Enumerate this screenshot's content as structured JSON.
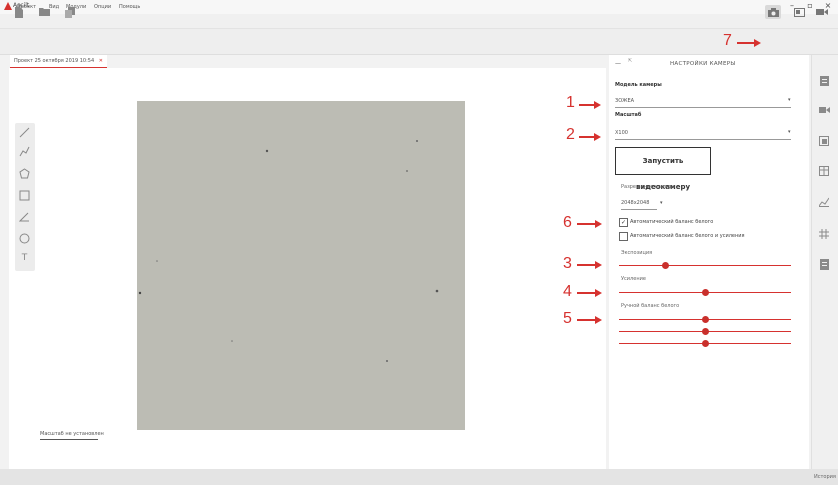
{
  "app": {
    "title": "Ascilt",
    "accent": "#d6322f"
  },
  "window_controls": {
    "minimize": "–",
    "maximize": "▫",
    "close": "×"
  },
  "menu": {
    "items": [
      "Проект",
      "Вид",
      "Модули",
      "Опции",
      "Помощь"
    ]
  },
  "toolbar": {
    "left_icons": [
      "new-file-icon",
      "open-folder-icon",
      "copy-icon"
    ],
    "right_icons": [
      "camera-icon",
      "image-window-icon",
      "video-camera-icon"
    ]
  },
  "annotations": {
    "n1": "1",
    "n2": "2",
    "n3": "3",
    "n4": "4",
    "n5": "5",
    "n6": "6",
    "n7": "7"
  },
  "document_tab": {
    "label": "Проект 25 октября 2019 10:54",
    "close": "✕"
  },
  "drawing_tools": [
    "line-tool-icon",
    "polyline-tool-icon",
    "polygon-tool-icon",
    "rectangle-tool-icon",
    "angle-tool-icon",
    "circle-tool-icon",
    "text-tool-icon"
  ],
  "text_tool_glyph": "T",
  "scale_status": "Масштаб не установлен",
  "camera_panel": {
    "collapse": "—",
    "pin": "⇱",
    "title": "НАСТРОЙКИ КАМЕРЫ",
    "camera_model_label": "Модель камеры",
    "camera_model_value": "ЗОЖЕА",
    "scale_label": "Масштаб",
    "scale_value": "Х100",
    "start_button": "Запустить видеокамеру",
    "resolution_label": "Разрешение камеры",
    "resolution_value": "2048x2048",
    "auto_wb_label": "Автоматический баланс белого",
    "auto_wb_checked": true,
    "auto_wb_gain_label": "Автоматический баланс белого и усиления",
    "auto_wb_gain_checked": false,
    "exposure_label": "Экспозиция",
    "exposure": 0.27,
    "gain_label": "Усиление",
    "gain": 0.5,
    "manual_wb_label": "Ручной баланс белого",
    "manual_wb": [
      0.5,
      0.5,
      0.5
    ],
    "caret": "▾",
    "checkmark": "✓"
  },
  "right_sidebar_icons": [
    "module-1-icon",
    "camera-module-icon",
    "gallery-icon",
    "table-icon",
    "chart-icon",
    "hash-icon",
    "report-icon"
  ],
  "status": {
    "history": "История"
  }
}
